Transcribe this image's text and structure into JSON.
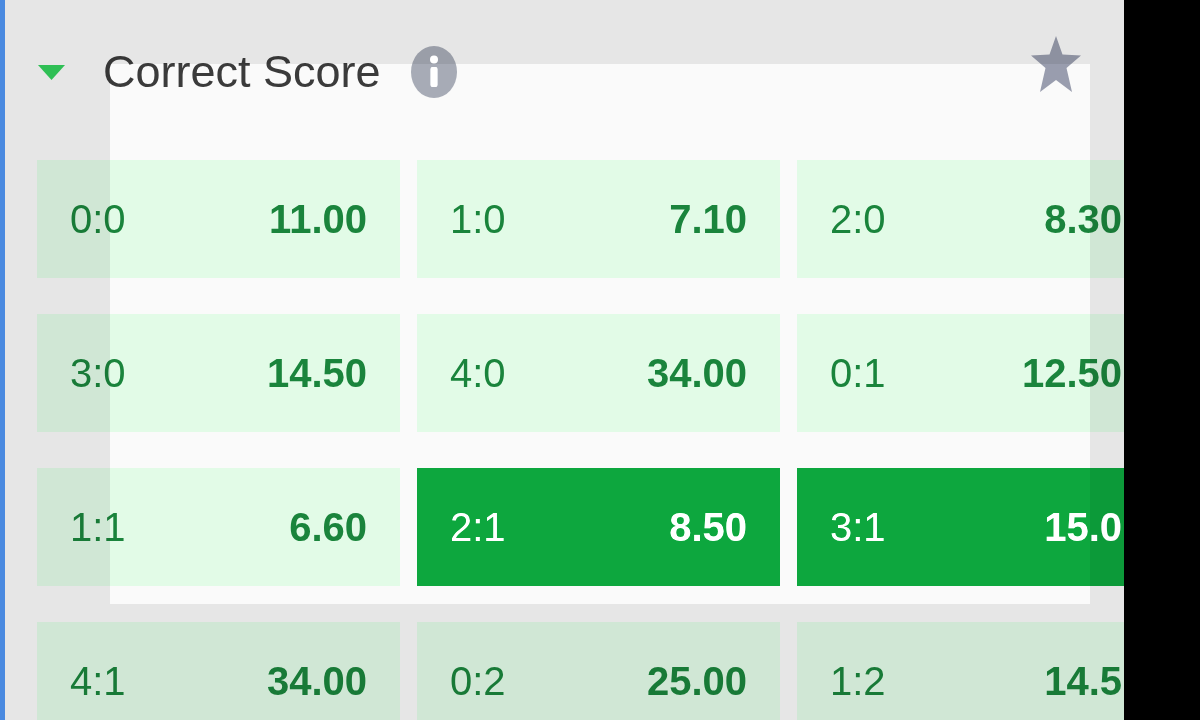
{
  "market": {
    "title": "Correct Score",
    "expanded": true,
    "starred": false
  },
  "outcomes": [
    {
      "score": "0:0",
      "odds": "11.00",
      "selected": false
    },
    {
      "score": "1:0",
      "odds": "7.10",
      "selected": false
    },
    {
      "score": "2:0",
      "odds": "8.30",
      "selected": false
    },
    {
      "score": "3:0",
      "odds": "14.50",
      "selected": false
    },
    {
      "score": "4:0",
      "odds": "34.00",
      "selected": false
    },
    {
      "score": "0:1",
      "odds": "12.50",
      "selected": false
    },
    {
      "score": "1:1",
      "odds": "6.60",
      "selected": false
    },
    {
      "score": "2:1",
      "odds": "8.50",
      "selected": true
    },
    {
      "score": "3:1",
      "odds": "15.0",
      "selected": true
    },
    {
      "score": "4:1",
      "odds": "34.00",
      "selected": false
    },
    {
      "score": "0:2",
      "odds": "25.00",
      "selected": false
    },
    {
      "score": "1:2",
      "odds": "14.5",
      "selected": false
    }
  ]
}
